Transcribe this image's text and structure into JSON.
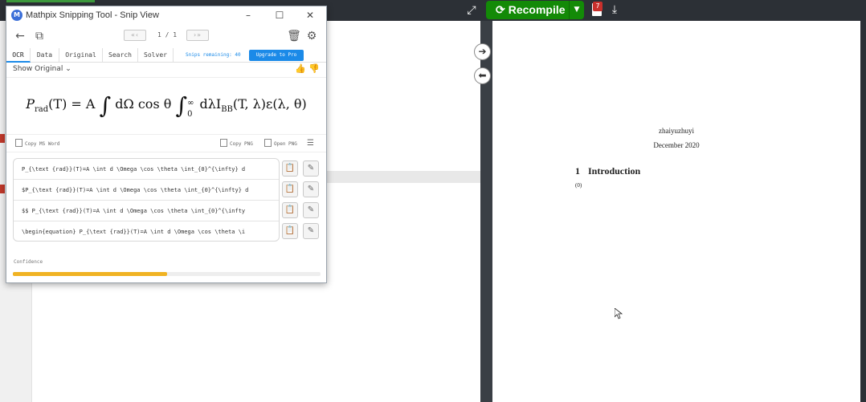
{
  "overleaf": {
    "recompile_label": "Recompile",
    "logs_badge": "7",
    "pdf": {
      "author": "zhaiyuzhuyi",
      "date": "December 2020",
      "section_number": "1",
      "section_title": "Introduction",
      "equation_number": "(0)"
    }
  },
  "mathpix": {
    "title": "Mathpix Snipping Tool - Snip View",
    "pager": "1 / 1",
    "tabs": [
      {
        "label": "OCR",
        "active": true
      },
      {
        "label": "Data",
        "active": false
      },
      {
        "label": "Original",
        "active": false
      },
      {
        "label": "Search",
        "active": false
      },
      {
        "label": "Solver",
        "active": false
      }
    ],
    "snips_remaining": "Snips remaining: 40",
    "upgrade_label": "Upgrade to Pro",
    "show_original": "Show Original",
    "formula": {
      "lhs": "P",
      "lhs_sub": "rad",
      "lhs_arg": "(T) = A",
      "int1": "∫",
      "mid": "dΩ cos θ",
      "int2": "∫",
      "upper": "∞",
      "lower": "0",
      "rhs": "dλI",
      "rhs_sub": "BB",
      "rhs_tail": "(T, λ)ε(λ, θ)"
    },
    "actions": {
      "copy_ms_word": "Copy MS Word",
      "copy_png": "Copy PNG",
      "open_png": "Open PNG"
    },
    "results": [
      "P_{\\text {rad}}(T)=A \\int d \\Omega \\cos \\theta \\int_{0}^{\\infty} d",
      "$P_{\\text {rad}}(T)=A \\int d \\Omega \\cos \\theta \\int_{0}^{\\infty} d",
      "$$  P_{\\text {rad}}(T)=A \\int d \\Omega \\cos \\theta \\int_{0}^{\\infty",
      "\\begin{equation}  P_{\\text {rad}}(T)=A \\int d \\Omega \\cos \\theta \\i"
    ],
    "confidence_label": "Confidence",
    "confidence_value": 0.5,
    "colors": {
      "accent": "#1b8ae8",
      "confidence": "#f0b323",
      "recompile": "#138a07"
    }
  }
}
